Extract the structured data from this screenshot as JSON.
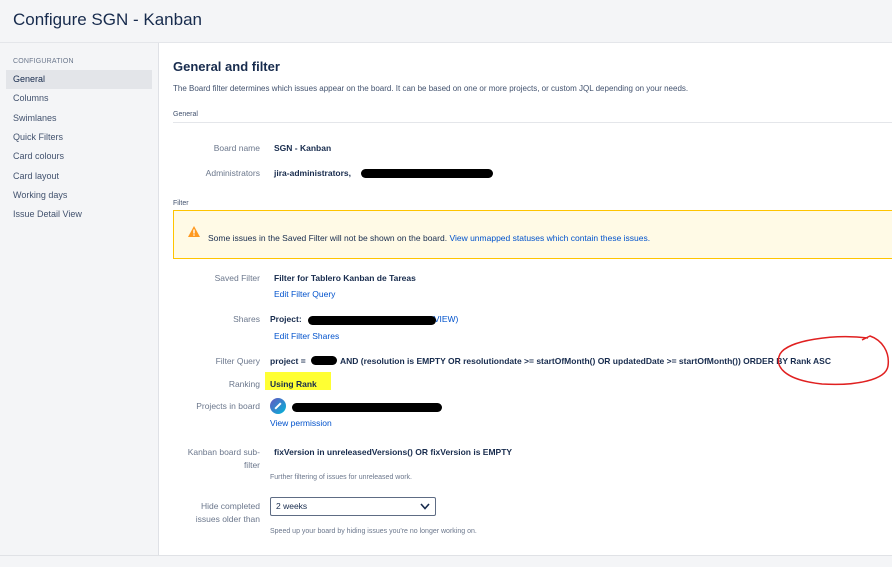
{
  "header": {
    "title": "Configure SGN - Kanban"
  },
  "sidebar": {
    "heading": "CONFIGURATION",
    "items": [
      {
        "label": "General",
        "active": true
      },
      {
        "label": "Columns"
      },
      {
        "label": "Swimlanes"
      },
      {
        "label": "Quick Filters"
      },
      {
        "label": "Card colours"
      },
      {
        "label": "Card layout"
      },
      {
        "label": "Working days"
      },
      {
        "label": "Issue Detail View"
      }
    ]
  },
  "main": {
    "title": "General and filter",
    "description": "The Board filter determines which issues appear on the board. It can be based on one or more projects, or custom JQL depending on your needs.",
    "general_section": "General",
    "board_name_label": "Board name",
    "board_name": "SGN - Kanban",
    "administrators_label": "Administrators",
    "administrators": "jira-administrators,",
    "filter_section": "Filter",
    "warning": {
      "text": "Some issues in the Saved Filter will not be shown on the board.",
      "link": "View unmapped statuses which contain these issues."
    },
    "saved_filter_label": "Saved Filter",
    "saved_filter": "Filter for Tablero Kanban de Tareas",
    "edit_filter_query": "Edit Filter Query",
    "shares_label": "Shares",
    "shares_prefix": "Project:",
    "shares_suffix": "(VIEW)",
    "edit_filter_shares": "Edit Filter Shares",
    "filter_query_label": "Filter Query",
    "filter_query_start": "project =",
    "filter_query_rest": "AND (resolution is EMPTY OR resolutiondate >= startOfMonth() OR updatedDate >= startOfMonth()) ORDER BY Rank ASC",
    "ranking_label": "Ranking",
    "ranking": "Using Rank",
    "projects_label": "Projects in board",
    "view_permission": "View permission",
    "subfilter_label_1": "Kanban board sub-",
    "subfilter_label_2": "filter",
    "subfilter": "fixVersion in unreleasedVersions() OR fixVersion is EMPTY",
    "subfilter_help": "Further filtering of issues for unreleased work.",
    "hide_label_1": "Hide completed",
    "hide_label_2": "issues older than",
    "hide_value": "2 weeks",
    "hide_help": "Speed up your board by hiding issues you're no longer working on."
  },
  "colors": {
    "link": "#0052cc",
    "warning_border": "#ffc400",
    "highlight": "#ffff33",
    "annotation": "#e02020"
  }
}
